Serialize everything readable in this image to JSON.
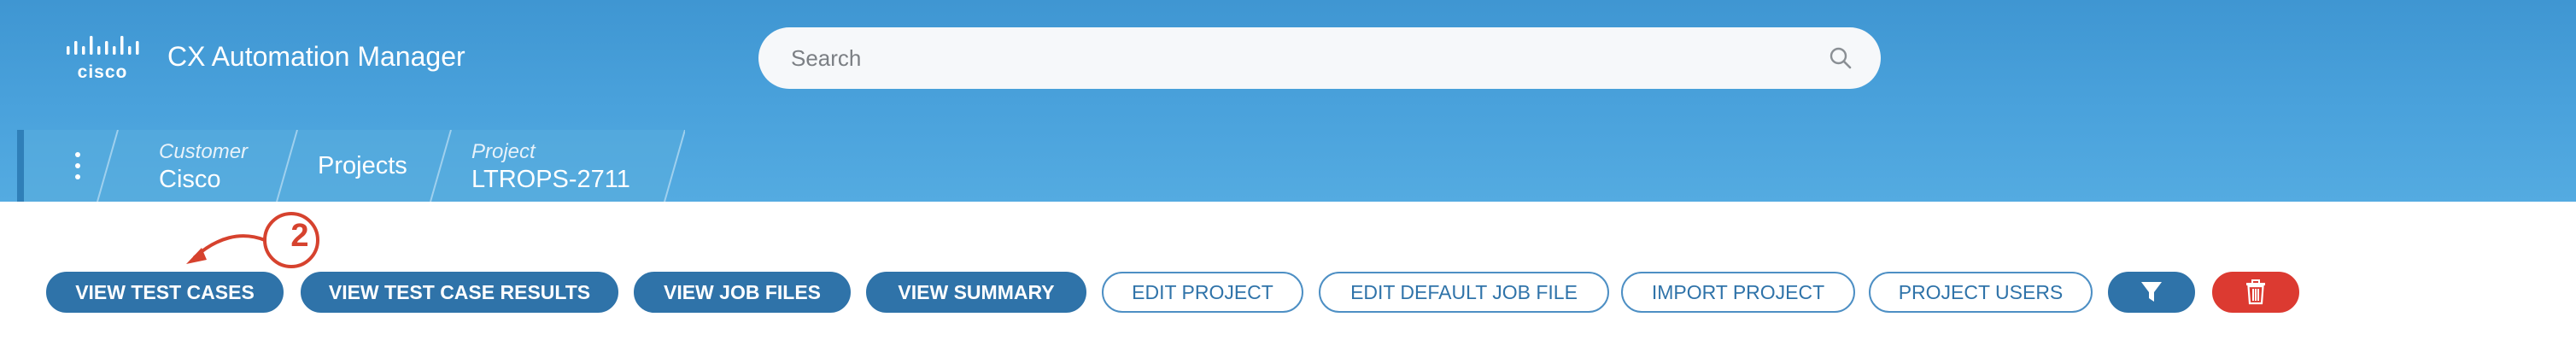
{
  "header": {
    "logo_text": "cisco",
    "app_title": "CX Automation Manager",
    "search_placeholder": "Search"
  },
  "breadcrumb": {
    "customer_label": "Customer",
    "customer_value": "Cisco",
    "projects_label": "Projects",
    "project_label": "Project",
    "project_value": "LTROPS-2711"
  },
  "toolbar": {
    "buttons": [
      {
        "label": "VIEW TEST CASES"
      },
      {
        "label": "VIEW TEST CASE RESULTS"
      },
      {
        "label": "VIEW JOB FILES"
      },
      {
        "label": "VIEW SUMMARY"
      },
      {
        "label": "EDIT PROJECT"
      },
      {
        "label": "EDIT DEFAULT JOB FILE"
      },
      {
        "label": "IMPORT PROJECT"
      },
      {
        "label": "PROJECT USERS"
      }
    ],
    "filter_icon": "funnel-icon",
    "delete_icon": "trash-icon"
  },
  "annotation": {
    "step_number": "2"
  },
  "colors": {
    "header_blue": "#4aa2dc",
    "primary_button": "#2f73a9",
    "danger_button": "#dc3a31",
    "annotation_red": "#d6422e"
  }
}
